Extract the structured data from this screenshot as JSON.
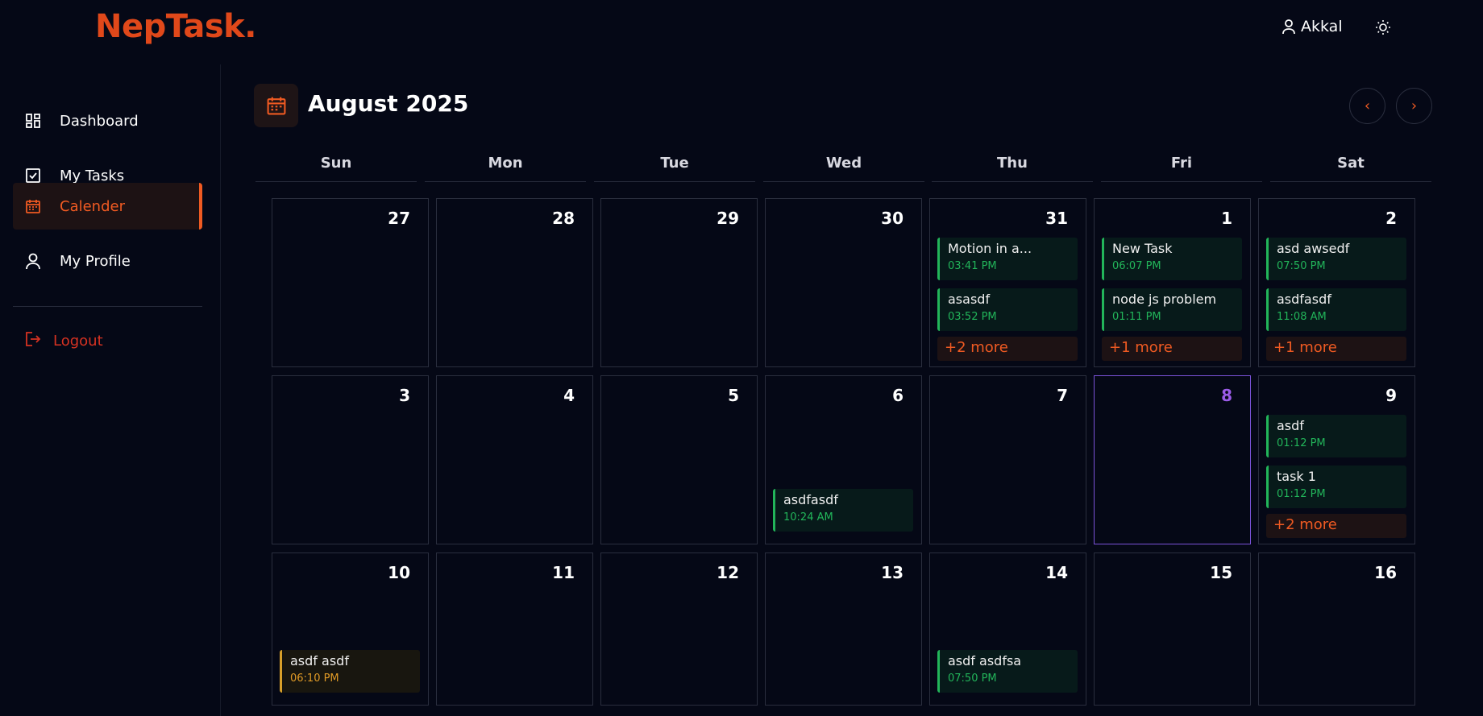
{
  "app": {
    "logo": "NepTask."
  },
  "header": {
    "user_name": "Akkal",
    "user_icon": "user-icon",
    "theme_icon": "sun-icon"
  },
  "sidebar": {
    "items": [
      {
        "label": "Dashboard",
        "icon": "grid-icon"
      },
      {
        "label": "My Tasks",
        "icon": "checkbox-icon"
      },
      {
        "label": "Calender",
        "icon": "calendar-icon"
      },
      {
        "label": "My Profile",
        "icon": "user-icon"
      }
    ],
    "logout": "Logout"
  },
  "calendar": {
    "month_title": "August 2025",
    "prev": "‹",
    "next": "›",
    "weekdays": [
      "Sun",
      "Mon",
      "Tue",
      "Wed",
      "Thu",
      "Fri",
      "Sat"
    ],
    "weeks": [
      [
        {
          "day": "27",
          "events": []
        },
        {
          "day": "28",
          "events": []
        },
        {
          "day": "29",
          "events": []
        },
        {
          "day": "30",
          "events": []
        },
        {
          "day": "31",
          "events": [
            {
              "title": "Motion in a...",
              "time": "03:41 PM"
            },
            {
              "title": "asasdf",
              "time": "03:52 PM"
            }
          ],
          "more": "+2 more"
        },
        {
          "day": "1",
          "events": [
            {
              "title": "New Task",
              "time": "06:07 PM"
            },
            {
              "title": "node js problem",
              "time": "01:11 PM"
            }
          ],
          "more": "+1 more"
        },
        {
          "day": "2",
          "events": [
            {
              "title": "asd awsedf",
              "time": "07:50 PM"
            },
            {
              "title": "asdfasdf",
              "time": "11:08 AM"
            }
          ],
          "more": "+1 more"
        }
      ],
      [
        {
          "day": "3",
          "events": []
        },
        {
          "day": "4",
          "events": []
        },
        {
          "day": "5",
          "events": []
        },
        {
          "day": "6",
          "events_bottom": [
            {
              "title": "asdfasdf",
              "time": "10:24 AM"
            }
          ]
        },
        {
          "day": "7",
          "events": []
        },
        {
          "day": "8",
          "today": true,
          "events": []
        },
        {
          "day": "9",
          "events": [
            {
              "title": "asdf",
              "time": "01:12 PM"
            },
            {
              "title": "task 1",
              "time": "01:12 PM"
            }
          ],
          "more": "+2 more"
        }
      ],
      [
        {
          "day": "10",
          "events_bottom": [
            {
              "title": "asdf asdf",
              "time": "06:10 PM",
              "status": "warn"
            }
          ]
        },
        {
          "day": "11",
          "events": []
        },
        {
          "day": "12",
          "events": []
        },
        {
          "day": "13",
          "events": []
        },
        {
          "day": "14",
          "events_bottom": [
            {
              "title": "asdf asdfsa",
              "time": "07:50 PM"
            }
          ]
        },
        {
          "day": "15",
          "events": []
        },
        {
          "day": "16",
          "events": []
        }
      ]
    ]
  },
  "colors": {
    "accent": "#ef5a22",
    "success": "#22b55a",
    "warning": "#e09a26",
    "today": "#9c5ce8",
    "danger": "#d63222"
  }
}
